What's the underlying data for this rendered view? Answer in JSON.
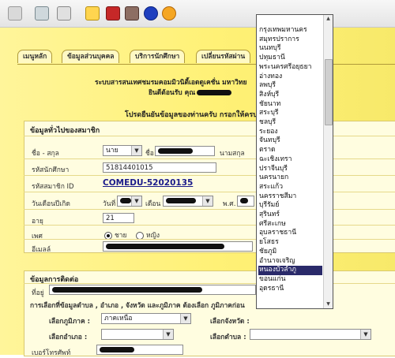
{
  "toolbar": {
    "icons": [
      "mail-icon",
      "print-icon",
      "edit-icon",
      "note-icon",
      "calculator-icon",
      "movie-icon",
      "bluetooth-icon",
      "browser-icon"
    ]
  },
  "tabs": [
    "เมนูหลัก",
    "ข้อมูลส่วนบุคคล",
    "บริการนักศึกษา",
    "เปลี่ยนรหัสผ่าน"
  ],
  "header": {
    "line1": "ระบบสารสนเทศชมรมคอมมิวนิตี้เอดดูเคชั่น มหาวิทย",
    "line2": "ยินดีต้อนรับ คุณ",
    "line3": "โปรดยืนยันข้อมูลของท่านครับ กรอกให้ครบ"
  },
  "general": {
    "title": "ข้อมูลทั่วไปของสมาชิก",
    "name_label": "ชื่อ - สกุล",
    "title_value": "นาย",
    "first_label": "ชื่อ",
    "last_label": "นามสกุล",
    "student_id_label": "รหัสนักศึกษา",
    "student_id": "51814401015",
    "member_id_label": "รหัสสมาชิก ID",
    "member_id": "COMEDU-52020135",
    "birth_label": "วันเดือนปีเกิด",
    "day_label": "วันที่",
    "month_label": "เดือน",
    "year_label": "พ.ศ.",
    "age_label": "อายุ",
    "age": "21",
    "gender_label": "เพศ",
    "male": "ชาย",
    "female": "หญิง",
    "email_label": "อีเมลล์"
  },
  "contact": {
    "title": "ข้อมูลการติดต่อ",
    "address_label": "ที่อยู่",
    "note": "การเลือกที่ข้อมูลตำบล , อำเภอ , จังหวัด และภูมิภาค ต้องเลือก ภูมิภาคก่อน",
    "region_label": "เลือกภูมิภาค :",
    "region_value": "ภาคเหนือ",
    "province_label": "เลือกจังหวัด :",
    "district_label": "เลือกอำเภอ :",
    "subdistrict_label": "เลือกตำบล :",
    "phone_label": "เบอร์โทรศัพท์"
  },
  "dropdown": {
    "items": [
      "กรุงเทพมหานคร",
      "สมุทรปราการ",
      "นนทบุรี",
      "ปทุมธานี",
      "พระนครศรีอยุธยา",
      "อ่างทอง",
      "ลพบุรี",
      "สิงห์บุรี",
      "ชัยนาท",
      "สระบุรี",
      "ชลบุรี",
      "ระยอง",
      "จันทบุรี",
      "ตราด",
      "ฉะเชิงเทรา",
      "ปราจีนบุรี",
      "นครนายก",
      "สระแก้ว",
      "นครราชสีมา",
      "บุรีรัมย์",
      "สุรินทร์",
      "ศรีสะเกษ",
      "อุบลราชธานี",
      "ยโสธร",
      "ชัยภูมิ",
      "อำนาจเจริญ",
      "หนองบัวลำภู",
      "ขอนแก่น",
      "อุดรธานี"
    ],
    "selected": "หนองบัวลำภู"
  }
}
